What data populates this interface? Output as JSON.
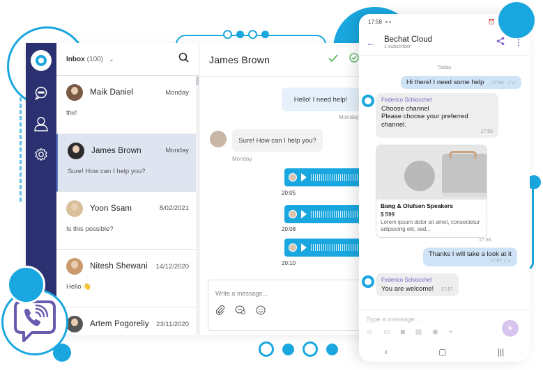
{
  "colors": {
    "accent": "#1aa7df",
    "rail": "#2b3170",
    "viber": "#6a5bb0",
    "phone_accent": "#7b5fc7"
  },
  "sidebar": {
    "icons": [
      "logo-icon",
      "chat-icon",
      "user-icon",
      "gear-icon"
    ]
  },
  "inbox": {
    "title": "Inbox",
    "count": "(100)",
    "conversations": [
      {
        "name": "Maik Daniel",
        "date": "Monday",
        "preview": "thx!",
        "active": false
      },
      {
        "name": "James Brown",
        "date": "Monday",
        "preview": "Sure! How can I help you?",
        "active": true
      },
      {
        "name": "Yoon Ssam",
        "date": "8/02/2021",
        "preview": "Is this possible?",
        "active": false
      },
      {
        "name": "Nitesh Shewani",
        "date": "14/12/2020",
        "preview": "Hello 👋",
        "active": false
      },
      {
        "name": "Artem Pogoreliy",
        "date": "23/11/2020",
        "preview": "",
        "active": false
      }
    ]
  },
  "chat": {
    "title": "James Brown",
    "messages": [
      {
        "type": "text",
        "direction": "out",
        "text": "Hello! I need help!",
        "time": "Monday"
      },
      {
        "type": "text",
        "direction": "in",
        "text": "Sure! How can I help you?",
        "time": "Monday"
      },
      {
        "type": "voice",
        "direction": "out",
        "time": "20:05"
      },
      {
        "type": "voice",
        "direction": "out",
        "time": "20:08"
      },
      {
        "type": "voice",
        "direction": "out",
        "time": "20:10"
      }
    ],
    "composer_placeholder": "Write a message..."
  },
  "phone": {
    "status_time": "17:58",
    "channel_name": "Bechat Cloud",
    "subscribers": "1 subscriber",
    "day_label": "Today",
    "messages": [
      {
        "direction": "out",
        "text": "Hi there! I need some help",
        "time": "17:54"
      },
      {
        "direction": "in",
        "sender": "Federico Schiocchet",
        "title": "Choose channel",
        "text": "Please choose your preferred channel.",
        "time": "17:56"
      },
      {
        "direction": "in",
        "type": "card",
        "title": "Bang & Olufsen Speakers",
        "price": "$ 599",
        "desc": "Lorem ipsum dolor sit amet, consectetur adipiscing elit, sed...",
        "time": "17:56"
      },
      {
        "direction": "out",
        "text": "Thanks I will take a look at it",
        "time": "17:57"
      },
      {
        "direction": "in",
        "sender": "Federico Schiocchet",
        "text": "You are welcome!",
        "time": "17:57"
      }
    ],
    "composer_placeholder": "Type a message..."
  }
}
